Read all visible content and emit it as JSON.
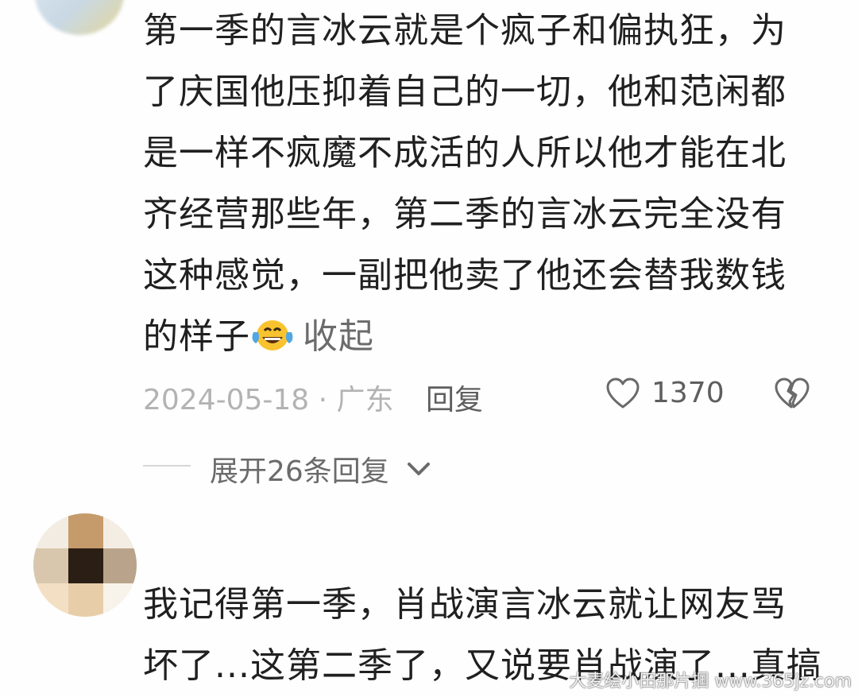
{
  "comment1": {
    "lines": [
      "第一季的言冰云就是个疯子和偏执狂，为",
      "了庆国他压抑着自己的一切，他和范闲都",
      "是一样不疯魔不成活的人所以他才能在北",
      "齐经营那些年，第二季的言冰云完全没有",
      "这种感觉，一副把他卖了他还会替我数钱",
      "的样子"
    ],
    "emoji": "laughing-tears-emoji",
    "collapse_label": "收起",
    "date": "2024-05-18 · 广东",
    "reply_label": "回复",
    "like_count": "1370",
    "expand_label": "展开26条回复"
  },
  "comment2": {
    "lines": [
      "我记得第一季，肖战演言冰云就让网友骂",
      "坏了...这第二季了，又说要肖战演了...真搞"
    ]
  },
  "watermark": "大麦绘小田那片掴 www.365jz.com",
  "icons": {
    "like": "heart-icon",
    "dislike": "broken-heart-icon",
    "expand": "chevron-down-icon"
  }
}
